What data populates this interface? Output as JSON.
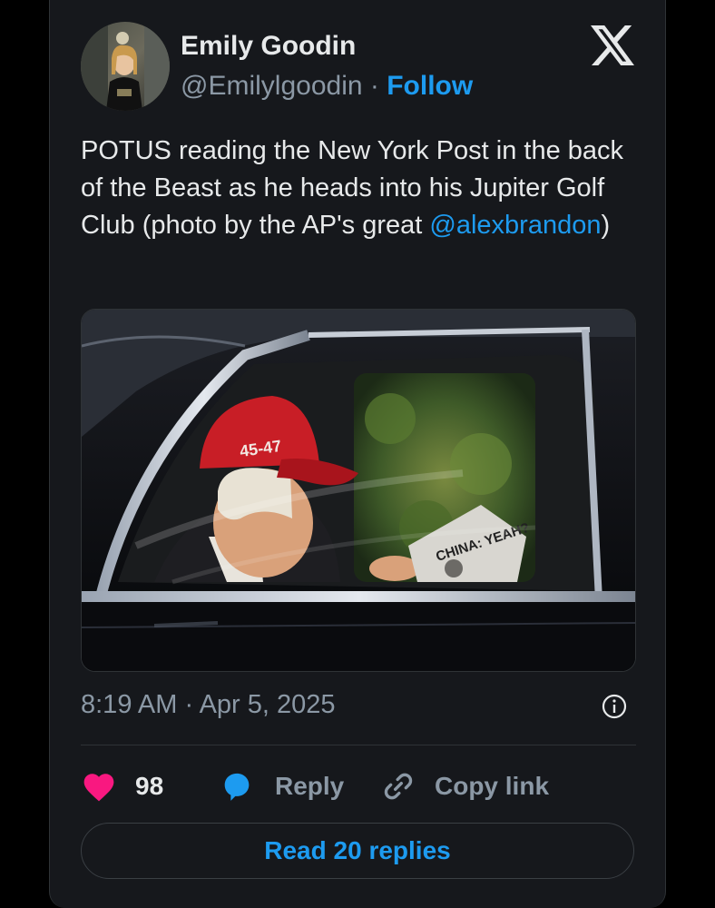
{
  "author": {
    "name": "Emily Goodin",
    "handle": "@Emilylgoodin",
    "separator": "·",
    "follow_label": "Follow"
  },
  "tweet": {
    "text_before_mention": "POTUS reading the New York Post in the back of the Beast as he heads into his Jupiter Golf Club (photo by the AP's great ",
    "mention": "@alexbrandon",
    "text_after_mention": ")",
    "timestamp": "8:19 AM · Apr 5, 2025"
  },
  "photo": {
    "hat_text": "45-47",
    "newspaper_headline": "CHINA: YEAH?"
  },
  "actions": {
    "like_count": "98",
    "reply_label": "Reply",
    "copy_link_label": "Copy link",
    "read_replies_label": "Read 20 replies"
  },
  "colors": {
    "background": "#000000",
    "card": "#16181c",
    "text": "#e7e9ea",
    "muted": "#8b98a5",
    "accent": "#1d9bf0",
    "like": "#f91880"
  },
  "icons": [
    "x-logo-icon",
    "info-icon",
    "heart-icon",
    "reply-bubble-icon",
    "link-icon"
  ]
}
